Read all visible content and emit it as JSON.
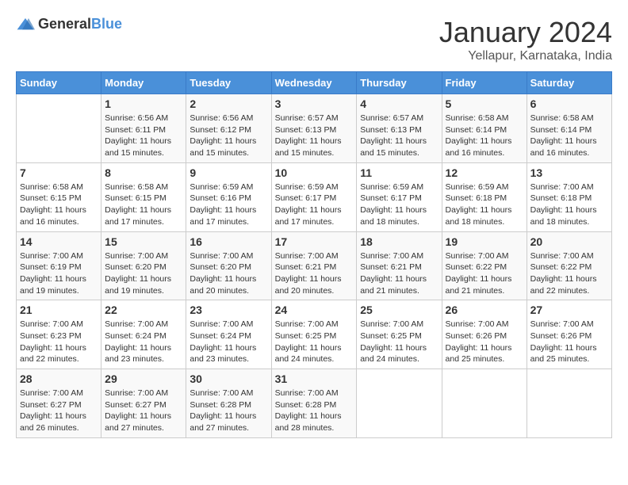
{
  "header": {
    "logo_general": "General",
    "logo_blue": "Blue",
    "title": "January 2024",
    "subtitle": "Yellapur, Karnataka, India"
  },
  "calendar": {
    "days_of_week": [
      "Sunday",
      "Monday",
      "Tuesday",
      "Wednesday",
      "Thursday",
      "Friday",
      "Saturday"
    ],
    "weeks": [
      [
        {
          "day": "",
          "info": ""
        },
        {
          "day": "1",
          "info": "Sunrise: 6:56 AM\nSunset: 6:11 PM\nDaylight: 11 hours\nand 15 minutes."
        },
        {
          "day": "2",
          "info": "Sunrise: 6:56 AM\nSunset: 6:12 PM\nDaylight: 11 hours\nand 15 minutes."
        },
        {
          "day": "3",
          "info": "Sunrise: 6:57 AM\nSunset: 6:13 PM\nDaylight: 11 hours\nand 15 minutes."
        },
        {
          "day": "4",
          "info": "Sunrise: 6:57 AM\nSunset: 6:13 PM\nDaylight: 11 hours\nand 15 minutes."
        },
        {
          "day": "5",
          "info": "Sunrise: 6:58 AM\nSunset: 6:14 PM\nDaylight: 11 hours\nand 16 minutes."
        },
        {
          "day": "6",
          "info": "Sunrise: 6:58 AM\nSunset: 6:14 PM\nDaylight: 11 hours\nand 16 minutes."
        }
      ],
      [
        {
          "day": "7",
          "info": "Sunrise: 6:58 AM\nSunset: 6:15 PM\nDaylight: 11 hours\nand 16 minutes."
        },
        {
          "day": "8",
          "info": "Sunrise: 6:58 AM\nSunset: 6:15 PM\nDaylight: 11 hours\nand 17 minutes."
        },
        {
          "day": "9",
          "info": "Sunrise: 6:59 AM\nSunset: 6:16 PM\nDaylight: 11 hours\nand 17 minutes."
        },
        {
          "day": "10",
          "info": "Sunrise: 6:59 AM\nSunset: 6:17 PM\nDaylight: 11 hours\nand 17 minutes."
        },
        {
          "day": "11",
          "info": "Sunrise: 6:59 AM\nSunset: 6:17 PM\nDaylight: 11 hours\nand 18 minutes."
        },
        {
          "day": "12",
          "info": "Sunrise: 6:59 AM\nSunset: 6:18 PM\nDaylight: 11 hours\nand 18 minutes."
        },
        {
          "day": "13",
          "info": "Sunrise: 7:00 AM\nSunset: 6:18 PM\nDaylight: 11 hours\nand 18 minutes."
        }
      ],
      [
        {
          "day": "14",
          "info": "Sunrise: 7:00 AM\nSunset: 6:19 PM\nDaylight: 11 hours\nand 19 minutes."
        },
        {
          "day": "15",
          "info": "Sunrise: 7:00 AM\nSunset: 6:20 PM\nDaylight: 11 hours\nand 19 minutes."
        },
        {
          "day": "16",
          "info": "Sunrise: 7:00 AM\nSunset: 6:20 PM\nDaylight: 11 hours\nand 20 minutes."
        },
        {
          "day": "17",
          "info": "Sunrise: 7:00 AM\nSunset: 6:21 PM\nDaylight: 11 hours\nand 20 minutes."
        },
        {
          "day": "18",
          "info": "Sunrise: 7:00 AM\nSunset: 6:21 PM\nDaylight: 11 hours\nand 21 minutes."
        },
        {
          "day": "19",
          "info": "Sunrise: 7:00 AM\nSunset: 6:22 PM\nDaylight: 11 hours\nand 21 minutes."
        },
        {
          "day": "20",
          "info": "Sunrise: 7:00 AM\nSunset: 6:22 PM\nDaylight: 11 hours\nand 22 minutes."
        }
      ],
      [
        {
          "day": "21",
          "info": "Sunrise: 7:00 AM\nSunset: 6:23 PM\nDaylight: 11 hours\nand 22 minutes."
        },
        {
          "day": "22",
          "info": "Sunrise: 7:00 AM\nSunset: 6:24 PM\nDaylight: 11 hours\nand 23 minutes."
        },
        {
          "day": "23",
          "info": "Sunrise: 7:00 AM\nSunset: 6:24 PM\nDaylight: 11 hours\nand 23 minutes."
        },
        {
          "day": "24",
          "info": "Sunrise: 7:00 AM\nSunset: 6:25 PM\nDaylight: 11 hours\nand 24 minutes."
        },
        {
          "day": "25",
          "info": "Sunrise: 7:00 AM\nSunset: 6:25 PM\nDaylight: 11 hours\nand 24 minutes."
        },
        {
          "day": "26",
          "info": "Sunrise: 7:00 AM\nSunset: 6:26 PM\nDaylight: 11 hours\nand 25 minutes."
        },
        {
          "day": "27",
          "info": "Sunrise: 7:00 AM\nSunset: 6:26 PM\nDaylight: 11 hours\nand 25 minutes."
        }
      ],
      [
        {
          "day": "28",
          "info": "Sunrise: 7:00 AM\nSunset: 6:27 PM\nDaylight: 11 hours\nand 26 minutes."
        },
        {
          "day": "29",
          "info": "Sunrise: 7:00 AM\nSunset: 6:27 PM\nDaylight: 11 hours\nand 27 minutes."
        },
        {
          "day": "30",
          "info": "Sunrise: 7:00 AM\nSunset: 6:28 PM\nDaylight: 11 hours\nand 27 minutes."
        },
        {
          "day": "31",
          "info": "Sunrise: 7:00 AM\nSunset: 6:28 PM\nDaylight: 11 hours\nand 28 minutes."
        },
        {
          "day": "",
          "info": ""
        },
        {
          "day": "",
          "info": ""
        },
        {
          "day": "",
          "info": ""
        }
      ]
    ]
  }
}
